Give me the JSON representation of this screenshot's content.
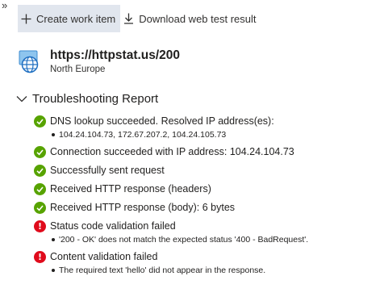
{
  "window": {
    "expand_glyph": "»"
  },
  "toolbar": {
    "create_label": "Create work item",
    "download_label": "Download web test result"
  },
  "resource": {
    "url": "https://httpstat.us/200",
    "region": "North Europe",
    "icon": "globe-icon"
  },
  "report": {
    "title": "Troubleshooting Report",
    "checks": [
      {
        "status": "success",
        "label": "DNS lookup succeeded. Resolved IP address(es):",
        "detail": "104.24.104.73, 172.67.207.2, 104.24.105.73"
      },
      {
        "status": "success",
        "label": "Connection succeeded with IP address: 104.24.104.73"
      },
      {
        "status": "success",
        "label": "Successfully sent request"
      },
      {
        "status": "success",
        "label": "Received HTTP response (headers)"
      },
      {
        "status": "success",
        "label": "Received HTTP response (body): 6 bytes"
      },
      {
        "status": "error",
        "label": "Status code validation failed",
        "detail": "'200 - OK' does not match the expected status '400 - BadRequest'."
      },
      {
        "status": "error",
        "label": "Content validation failed",
        "detail": "The required text 'hello' did not appear in the response."
      }
    ]
  },
  "colors": {
    "success": "#57a300",
    "error": "#e00b1c",
    "active_button_bg": "#e1e6ee"
  }
}
